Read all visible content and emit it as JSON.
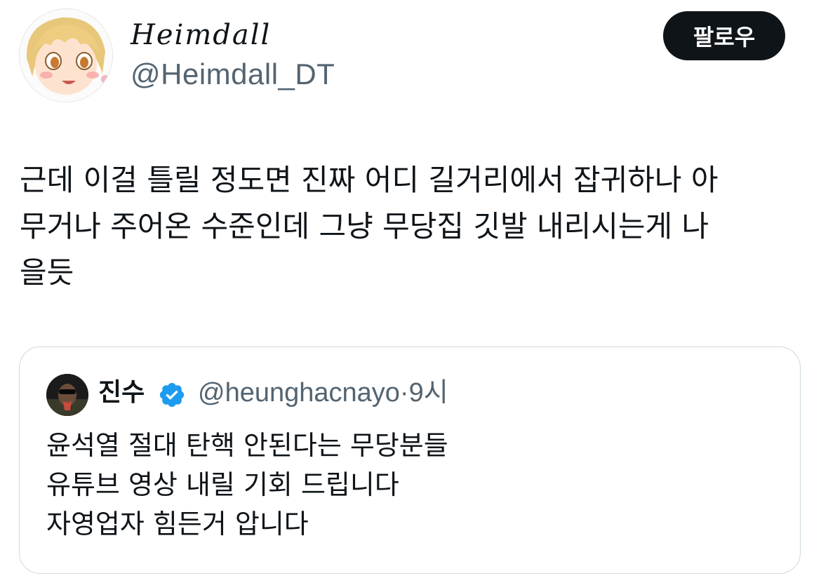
{
  "author": {
    "display_name": "Heimdall",
    "handle": "@Heimdall_DT",
    "avatar_icon": "anime-character-avatar"
  },
  "follow_button": {
    "label": "팔로우"
  },
  "tweet": {
    "lines": [
      "근데 이걸 틀릴 정도면 진짜 어디 길거리에서 잡귀하나 아",
      "무거나 주어온 수준인데 그냥 무당집 깃발 내리시는게 나",
      "을듯"
    ]
  },
  "quoted_tweet": {
    "author_name": "진수",
    "verified_icon": "verified-badge-icon",
    "handle": "@heunghacnayo",
    "separator": "·",
    "time": "9시",
    "lines": [
      "윤석열 절대 탄핵 안된다는 무당분들",
      "유튜브 영상 내릴 기회 드립니다",
      "자영업자 힘든거 압니다"
    ]
  },
  "colors": {
    "text_primary": "#0f1419",
    "text_secondary": "#536471",
    "follow_button_bg": "#0f1419",
    "card_border": "#cfd9de",
    "verified_blue": "#1d9bf0"
  }
}
